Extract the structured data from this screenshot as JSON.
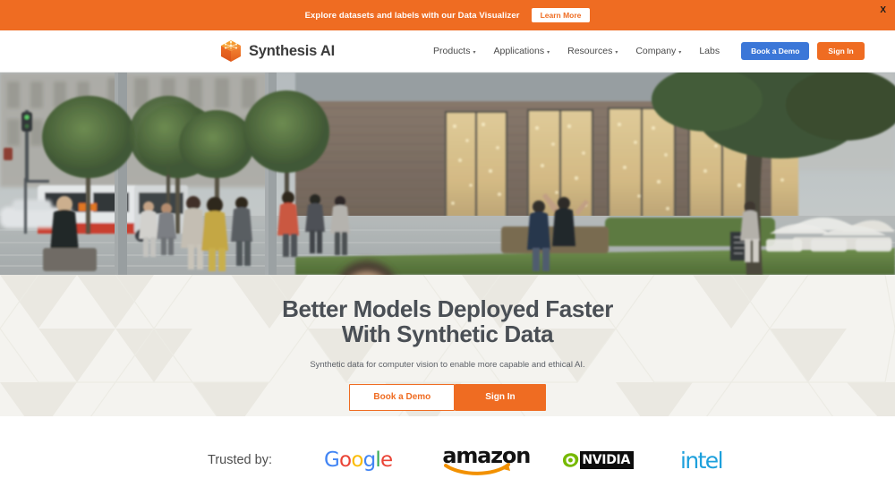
{
  "announcement": {
    "text": "Explore datasets and labels with our Data Visualizer",
    "cta_label": "Learn More",
    "close_label": "X",
    "bg_color": "#ef6c22"
  },
  "header": {
    "brand_name": "Synthesis AI",
    "logo_icon": "cube-logo-icon",
    "nav_items": [
      {
        "label": "Products",
        "has_dropdown": true,
        "caret": "▾"
      },
      {
        "label": "Applications",
        "has_dropdown": true,
        "caret": "▾"
      },
      {
        "label": "Resources",
        "has_dropdown": true,
        "caret": "▾"
      },
      {
        "label": "Company",
        "has_dropdown": true,
        "caret": "▾"
      },
      {
        "label": "Labs",
        "has_dropdown": false,
        "caret": ""
      }
    ],
    "book_demo_label": "Book a Demo",
    "book_demo_color": "#3b77d8",
    "signin_label": "Sign In",
    "signin_color": "#ef6c22"
  },
  "hero_media": {
    "alt": "Synthetic city street scene with pedestrians, trees, bus and brick storefront"
  },
  "hero": {
    "title_line1": "Better Models Deployed Faster",
    "title_line2": "With Synthetic Data",
    "subtitle": "Synthetic data for computer vision to enable more capable and ethical AI.",
    "book_demo_label": "Book a Demo",
    "signin_label": "Sign In",
    "accent_color": "#ef6c22",
    "bg_color": "#f3f2ee"
  },
  "trusted": {
    "label": "Trusted by:",
    "logos": [
      {
        "name": "Google",
        "letters": [
          "G",
          "o",
          "o",
          "g",
          "l",
          "e"
        ]
      },
      {
        "name": "amazon",
        "wordmark": "amazon"
      },
      {
        "name": "NVIDIA",
        "wordmark": "NVIDIA",
        "box_color": "#0d0d0d",
        "eye_color": "#76b900"
      },
      {
        "name": "intel",
        "wordmark": "intel",
        "color": "#1da0dc"
      }
    ]
  }
}
